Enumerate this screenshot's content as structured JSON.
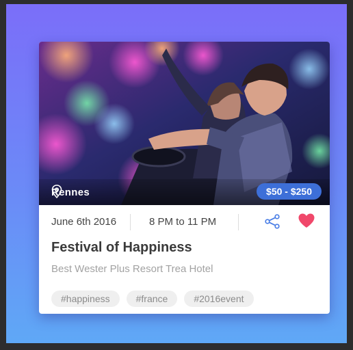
{
  "event": {
    "location": "Rennes",
    "price_range": "$50 - $250",
    "date": "June 6th 2016",
    "time": "8  PM to 11 PM",
    "title": "Festival of Happiness",
    "venue": "Best Wester Plus Resort Trea Hotel",
    "tags": [
      "#happiness",
      "#france",
      "#2016event"
    ],
    "favorited": true
  },
  "icons": {
    "location": "map-pin-icon",
    "share": "share-icon",
    "favorite": "heart-icon"
  },
  "colors": {
    "background_top": "#7b6ef9",
    "background_bottom": "#5fa8f6",
    "price_badge": "#3d6fd8",
    "share_icon": "#4a7ee6",
    "heart": "#f0476a",
    "title_text": "#3a3a3a",
    "venue_text": "#a2a2a2"
  }
}
